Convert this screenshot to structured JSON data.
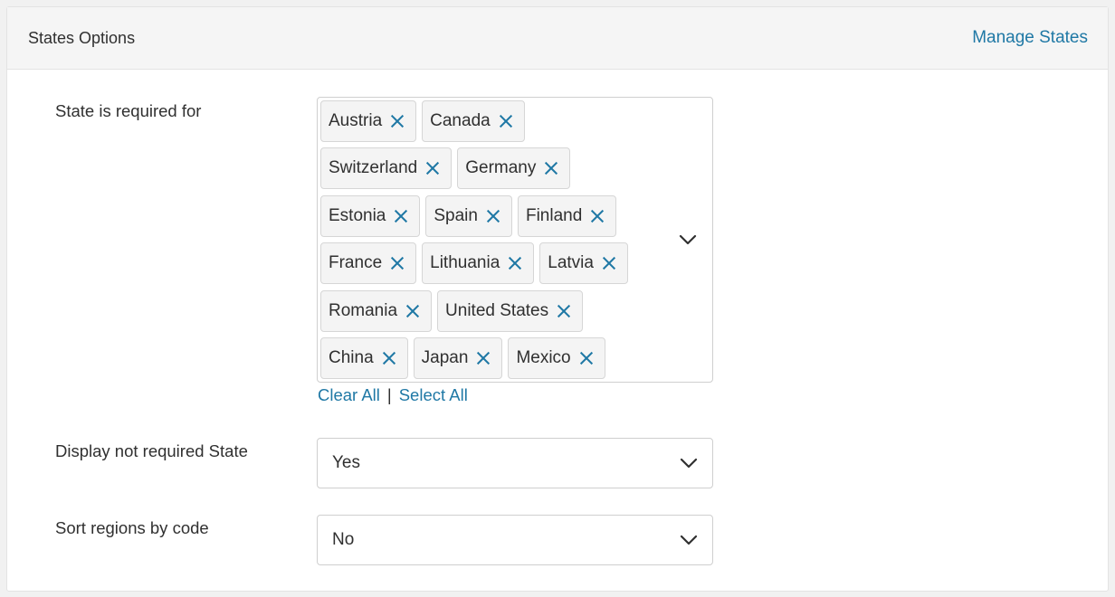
{
  "header": {
    "title": "States Options",
    "manage_link": "Manage States"
  },
  "state_required": {
    "label": "State is required for",
    "tag_rows": [
      [
        "Austria",
        "Canada"
      ],
      [
        "Switzerland",
        "Germany"
      ],
      [
        "Estonia",
        "Spain",
        "Finland"
      ],
      [
        "France",
        "Lithuania",
        "Latvia"
      ],
      [
        "Romania",
        "United States"
      ],
      [
        "China",
        "Japan",
        "Mexico"
      ]
    ],
    "clear_all": "Clear All",
    "separator": "|",
    "select_all": "Select All",
    "dropdown_icon": "chevron-down-icon",
    "remove_icon": "close-icon"
  },
  "display_not_required": {
    "label": "Display not required State",
    "value": "Yes"
  },
  "sort_by_code": {
    "label": "Sort regions by code",
    "value": "No"
  },
  "colors": {
    "link": "#1f78a5",
    "header_bg": "#f5f5f5",
    "tag_bg": "#f4f4f4"
  }
}
